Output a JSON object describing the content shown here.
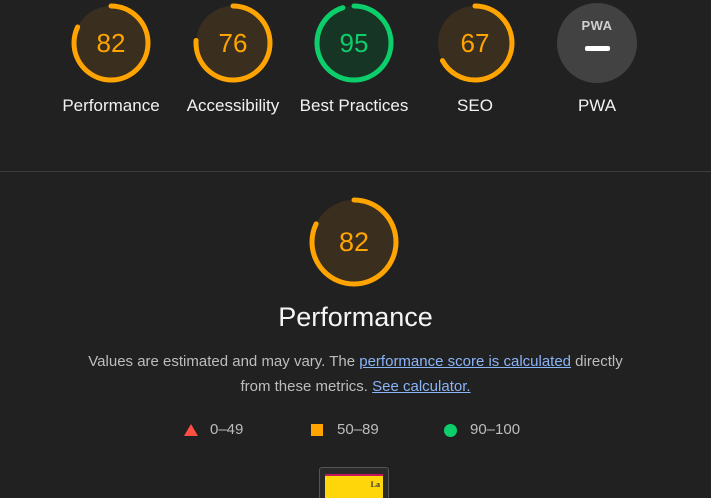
{
  "colors": {
    "background": "#212121",
    "pass": "#0cce6b",
    "average": "#ffa400",
    "fail": "#ff4e42",
    "link": "#8ab4f8"
  },
  "gauges": [
    {
      "score": "82",
      "label": "Performance",
      "status": "average",
      "fraction": 0.82
    },
    {
      "score": "76",
      "label": "Accessibility",
      "status": "average",
      "fraction": 0.76
    },
    {
      "score": "95",
      "label": "Best Practices",
      "status": "pass",
      "fraction": 0.95
    },
    {
      "score": "67",
      "label": "SEO",
      "status": "average",
      "fraction": 0.67
    },
    {
      "score": "",
      "label": "PWA",
      "status": "na",
      "fraction": 0,
      "badge_text": "PWA"
    }
  ],
  "performance": {
    "score": "82",
    "fraction": 0.82,
    "title": "Performance",
    "desc_prefix": "Values are estimated and may vary. The ",
    "score_link": "performance score is calculated",
    "desc_middle": " directly from these metrics. ",
    "calc_link": "See calculator."
  },
  "legend": [
    {
      "icon": "fail-triangle-icon",
      "range": "0–49"
    },
    {
      "icon": "average-square-icon",
      "range": "50–89"
    },
    {
      "icon": "pass-circle-icon",
      "range": "90–100"
    }
  ],
  "thumbnail": {
    "text": "La"
  }
}
